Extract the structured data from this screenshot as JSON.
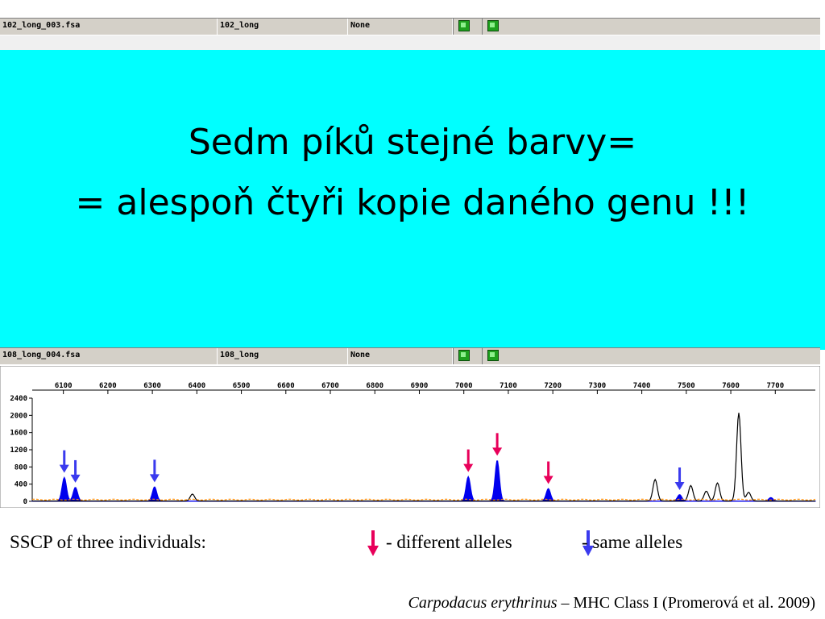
{
  "top_strip": {
    "file": "102_long_003.fsa",
    "name": "102_long",
    "status": "None"
  },
  "bottom_strip": {
    "file": "108_long_004.fsa",
    "name": "108_long",
    "status": "None"
  },
  "overlay": {
    "line1": "Sedm píků stejné barvy=",
    "line2": "= alespoň čtyři kopie daného genu !!!"
  },
  "legend": {
    "lead": "SSCP of three individuals:",
    "different": "- different alleles",
    "same": "- same alleles"
  },
  "citation": {
    "species": "Carpodacus erythrinus",
    "rest": " – MHC Class I (Promerová et al. 2009)"
  },
  "colors": {
    "overlay": "#00ffff",
    "blue_trace": "#0000ee",
    "black_trace": "#000000",
    "orange_trace": "#ff8c00",
    "different_arrow": "#e8005a",
    "same_arrow": "#3a3aee",
    "checkbox": "#1ea01e"
  },
  "icons": [
    "checkbox-icon",
    "different-allele-arrow-icon",
    "same-allele-arrow-icon"
  ],
  "chart_data": {
    "type": "line",
    "xlim": [
      6030,
      7790
    ],
    "ylim": [
      0,
      2400
    ],
    "x_ticks": [
      "6100",
      "6200",
      "6300",
      "6400",
      "6500",
      "6600",
      "6700",
      "6800",
      "6900",
      "7000",
      "7100",
      "7200",
      "7300",
      "7400",
      "7500",
      "7600",
      "7700"
    ],
    "y_ticks": [
      "2400",
      "2000",
      "1600",
      "1200",
      "800",
      "400",
      "0"
    ],
    "series": [
      {
        "color": "blue",
        "filled": true,
        "peaks": [
          [
            6102,
            550
          ],
          [
            6127,
            320
          ],
          [
            6305,
            330
          ],
          [
            7010,
            570
          ],
          [
            7075,
            950
          ],
          [
            7190,
            290
          ],
          [
            7485,
            150
          ],
          [
            7690,
            80
          ]
        ]
      },
      {
        "color": "black",
        "filled": false,
        "peaks": [
          [
            6390,
            160
          ],
          [
            7430,
            500
          ],
          [
            7510,
            360
          ],
          [
            7545,
            230
          ],
          [
            7570,
            420
          ],
          [
            7618,
            2050
          ],
          [
            7640,
            200
          ]
        ]
      },
      {
        "color": "orange",
        "filled": false,
        "baseline": 40
      }
    ],
    "arrows": [
      {
        "x": 6102,
        "type": "same"
      },
      {
        "x": 6127,
        "type": "same"
      },
      {
        "x": 6305,
        "type": "same"
      },
      {
        "x": 7010,
        "type": "different"
      },
      {
        "x": 7075,
        "type": "different"
      },
      {
        "x": 7190,
        "type": "different"
      },
      {
        "x": 7485,
        "type": "same"
      }
    ]
  }
}
